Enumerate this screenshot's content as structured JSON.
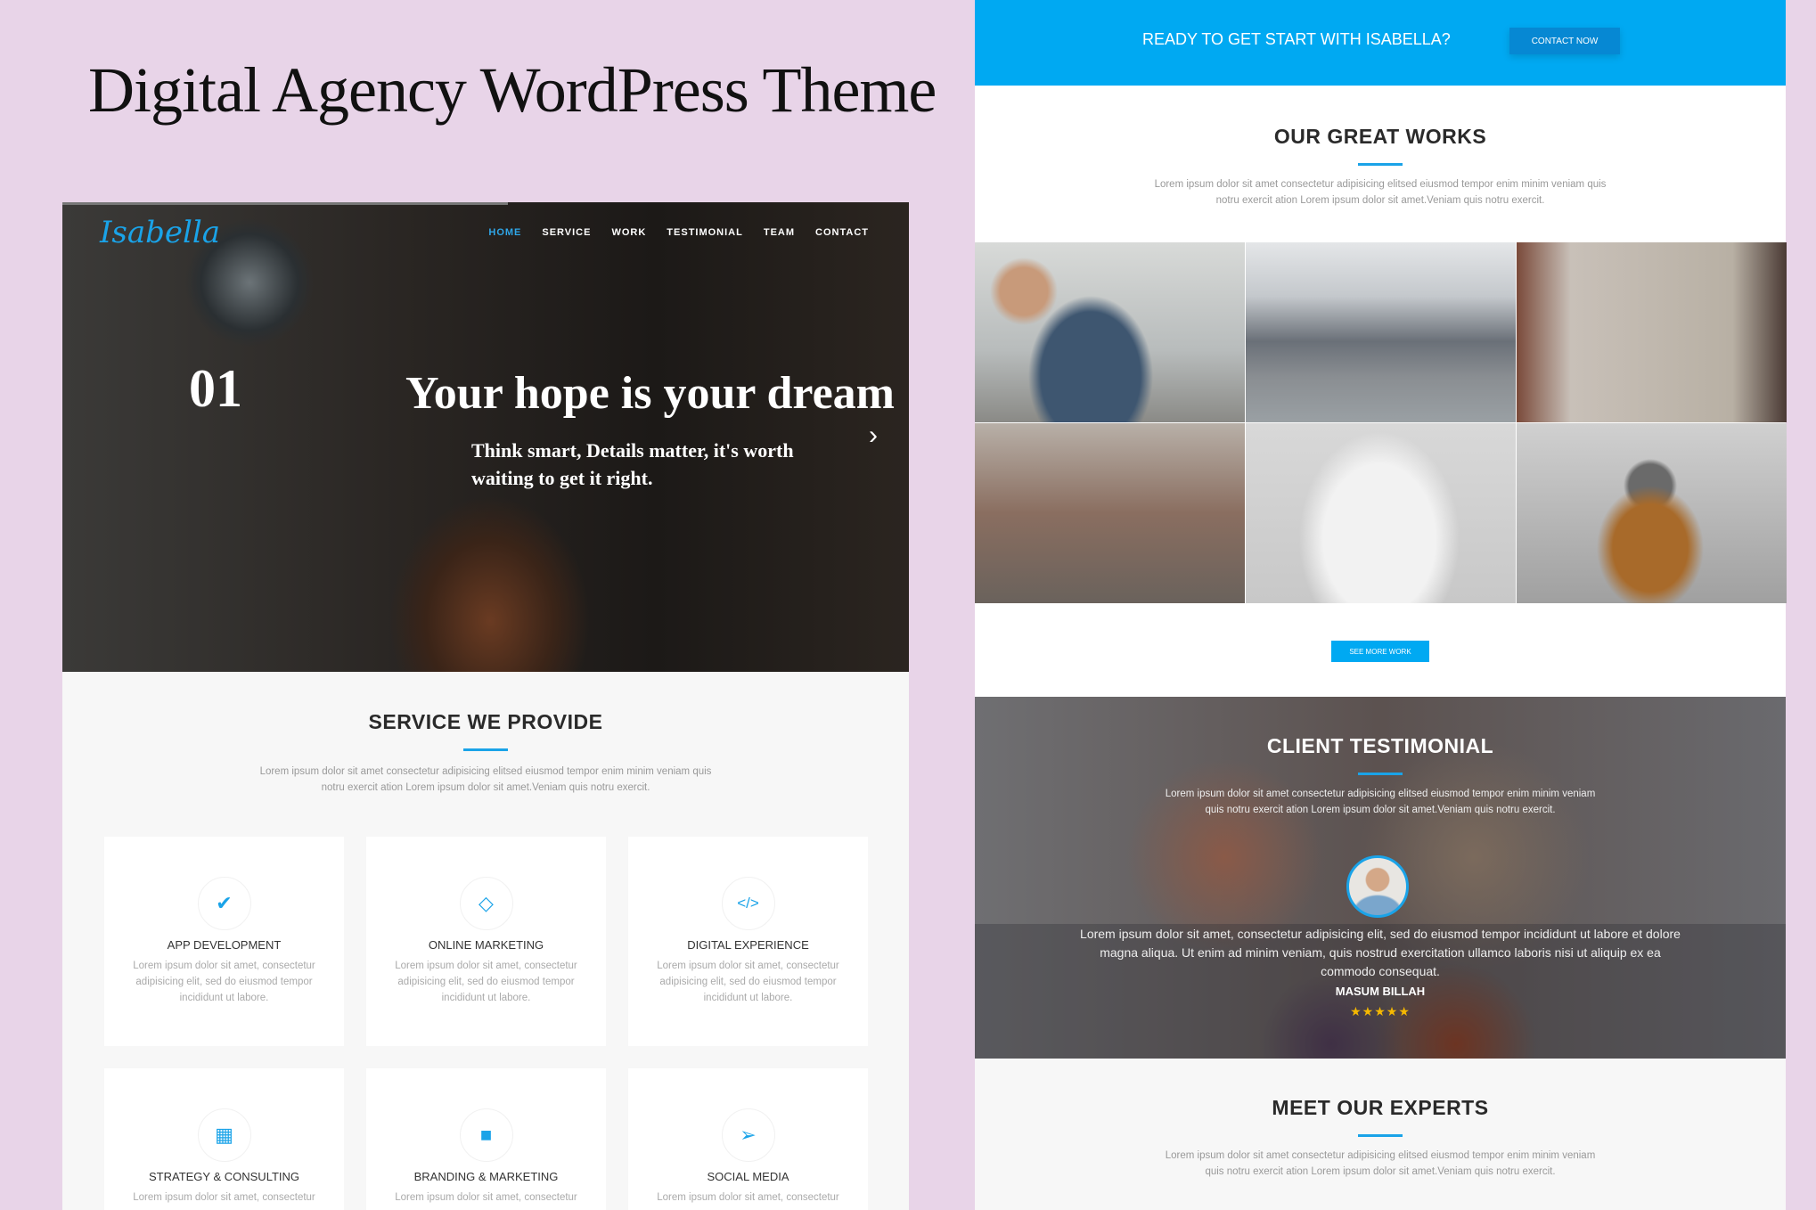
{
  "banner_title": "Digital Agency WordPress Theme",
  "colors": {
    "accent": "#1aa3e8",
    "cta_band": "#00a9f2",
    "background": "#e8d4e8"
  },
  "site": {
    "logo": "Isabella",
    "nav": [
      "HOME",
      "SERVICE",
      "WORK",
      "TESTIMONIAL",
      "TEAM",
      "CONTACT"
    ],
    "active_nav": "HOME"
  },
  "hero": {
    "slide_number": "01",
    "headline": "Your hope is your dream",
    "subline": "Think smart, Details matter, it's worth waiting to get it right.",
    "next_icon": "chevron-right"
  },
  "services": {
    "title": "SERVICE WE PROVIDE",
    "intro": "Lorem ipsum dolor sit amet consectetur adipisicing elitsed eiusmod tempor enim minim veniam quis notru exercit ation Lorem ipsum dolor sit amet.Veniam quis notru exercit.",
    "items": [
      {
        "icon": "check",
        "title": "APP DEVELOPMENT",
        "desc": "Lorem ipsum dolor sit amet, consectetur adipisicing elit, sed do eiusmod tempor incididunt ut labore."
      },
      {
        "icon": "diamond",
        "title": "ONLINE MARKETING",
        "desc": "Lorem ipsum dolor sit amet, consectetur adipisicing elit, sed do eiusmod tempor incididunt ut labore."
      },
      {
        "icon": "code",
        "title": "DIGITAL EXPERIENCE",
        "desc": "Lorem ipsum dolor sit amet, consectetur adipisicing elit, sed do eiusmod tempor incididunt ut labore."
      },
      {
        "icon": "building",
        "title": "STRATEGY & CONSULTING",
        "desc": "Lorem ipsum dolor sit amet, consectetur"
      },
      {
        "icon": "briefcase",
        "title": "BRANDING & MARKETING",
        "desc": "Lorem ipsum dolor sit amet, consectetur"
      },
      {
        "icon": "paper-plane",
        "title": "SOCIAL MEDIA",
        "desc": "Lorem ipsum dolor sit amet, consectetur"
      }
    ]
  },
  "cta": {
    "question": "READY TO GET START WITH ISABELLA?",
    "button": "CONTACT NOW"
  },
  "works": {
    "title": "OUR GREAT WORKS",
    "intro": "Lorem ipsum dolor sit amet consectetur adipisicing elitsed eiusmod tempor enim minim veniam quis notru exercit ation Lorem ipsum dolor sit amet.Veniam quis notru exercit.",
    "button": "SEE MORE WORK"
  },
  "testimonial": {
    "title": "CLIENT TESTIMONIAL",
    "intro": "Lorem ipsum dolor sit amet consectetur adipisicing elitsed eiusmod tempor enim minim veniam quis notru exercit ation Lorem ipsum dolor sit amet.Veniam quis notru exercit.",
    "quote": "Lorem ipsum dolor sit amet, consectetur adipisicing elit, sed do eiusmod tempor incididunt ut labore et dolore magna aliqua. Ut enim ad minim veniam, quis nostrud exercitation ullamco laboris nisi ut aliquip ex ea commodo consequat.",
    "author": "MASUM BILLAH",
    "rating": 5,
    "stars": "★★★★★"
  },
  "experts": {
    "title": "MEET OUR EXPERTS",
    "intro": "Lorem ipsum dolor sit amet consectetur adipisicing elitsed eiusmod tempor enim minim veniam quis notru exercit ation Lorem ipsum dolor sit amet.Veniam quis notru exercit."
  }
}
